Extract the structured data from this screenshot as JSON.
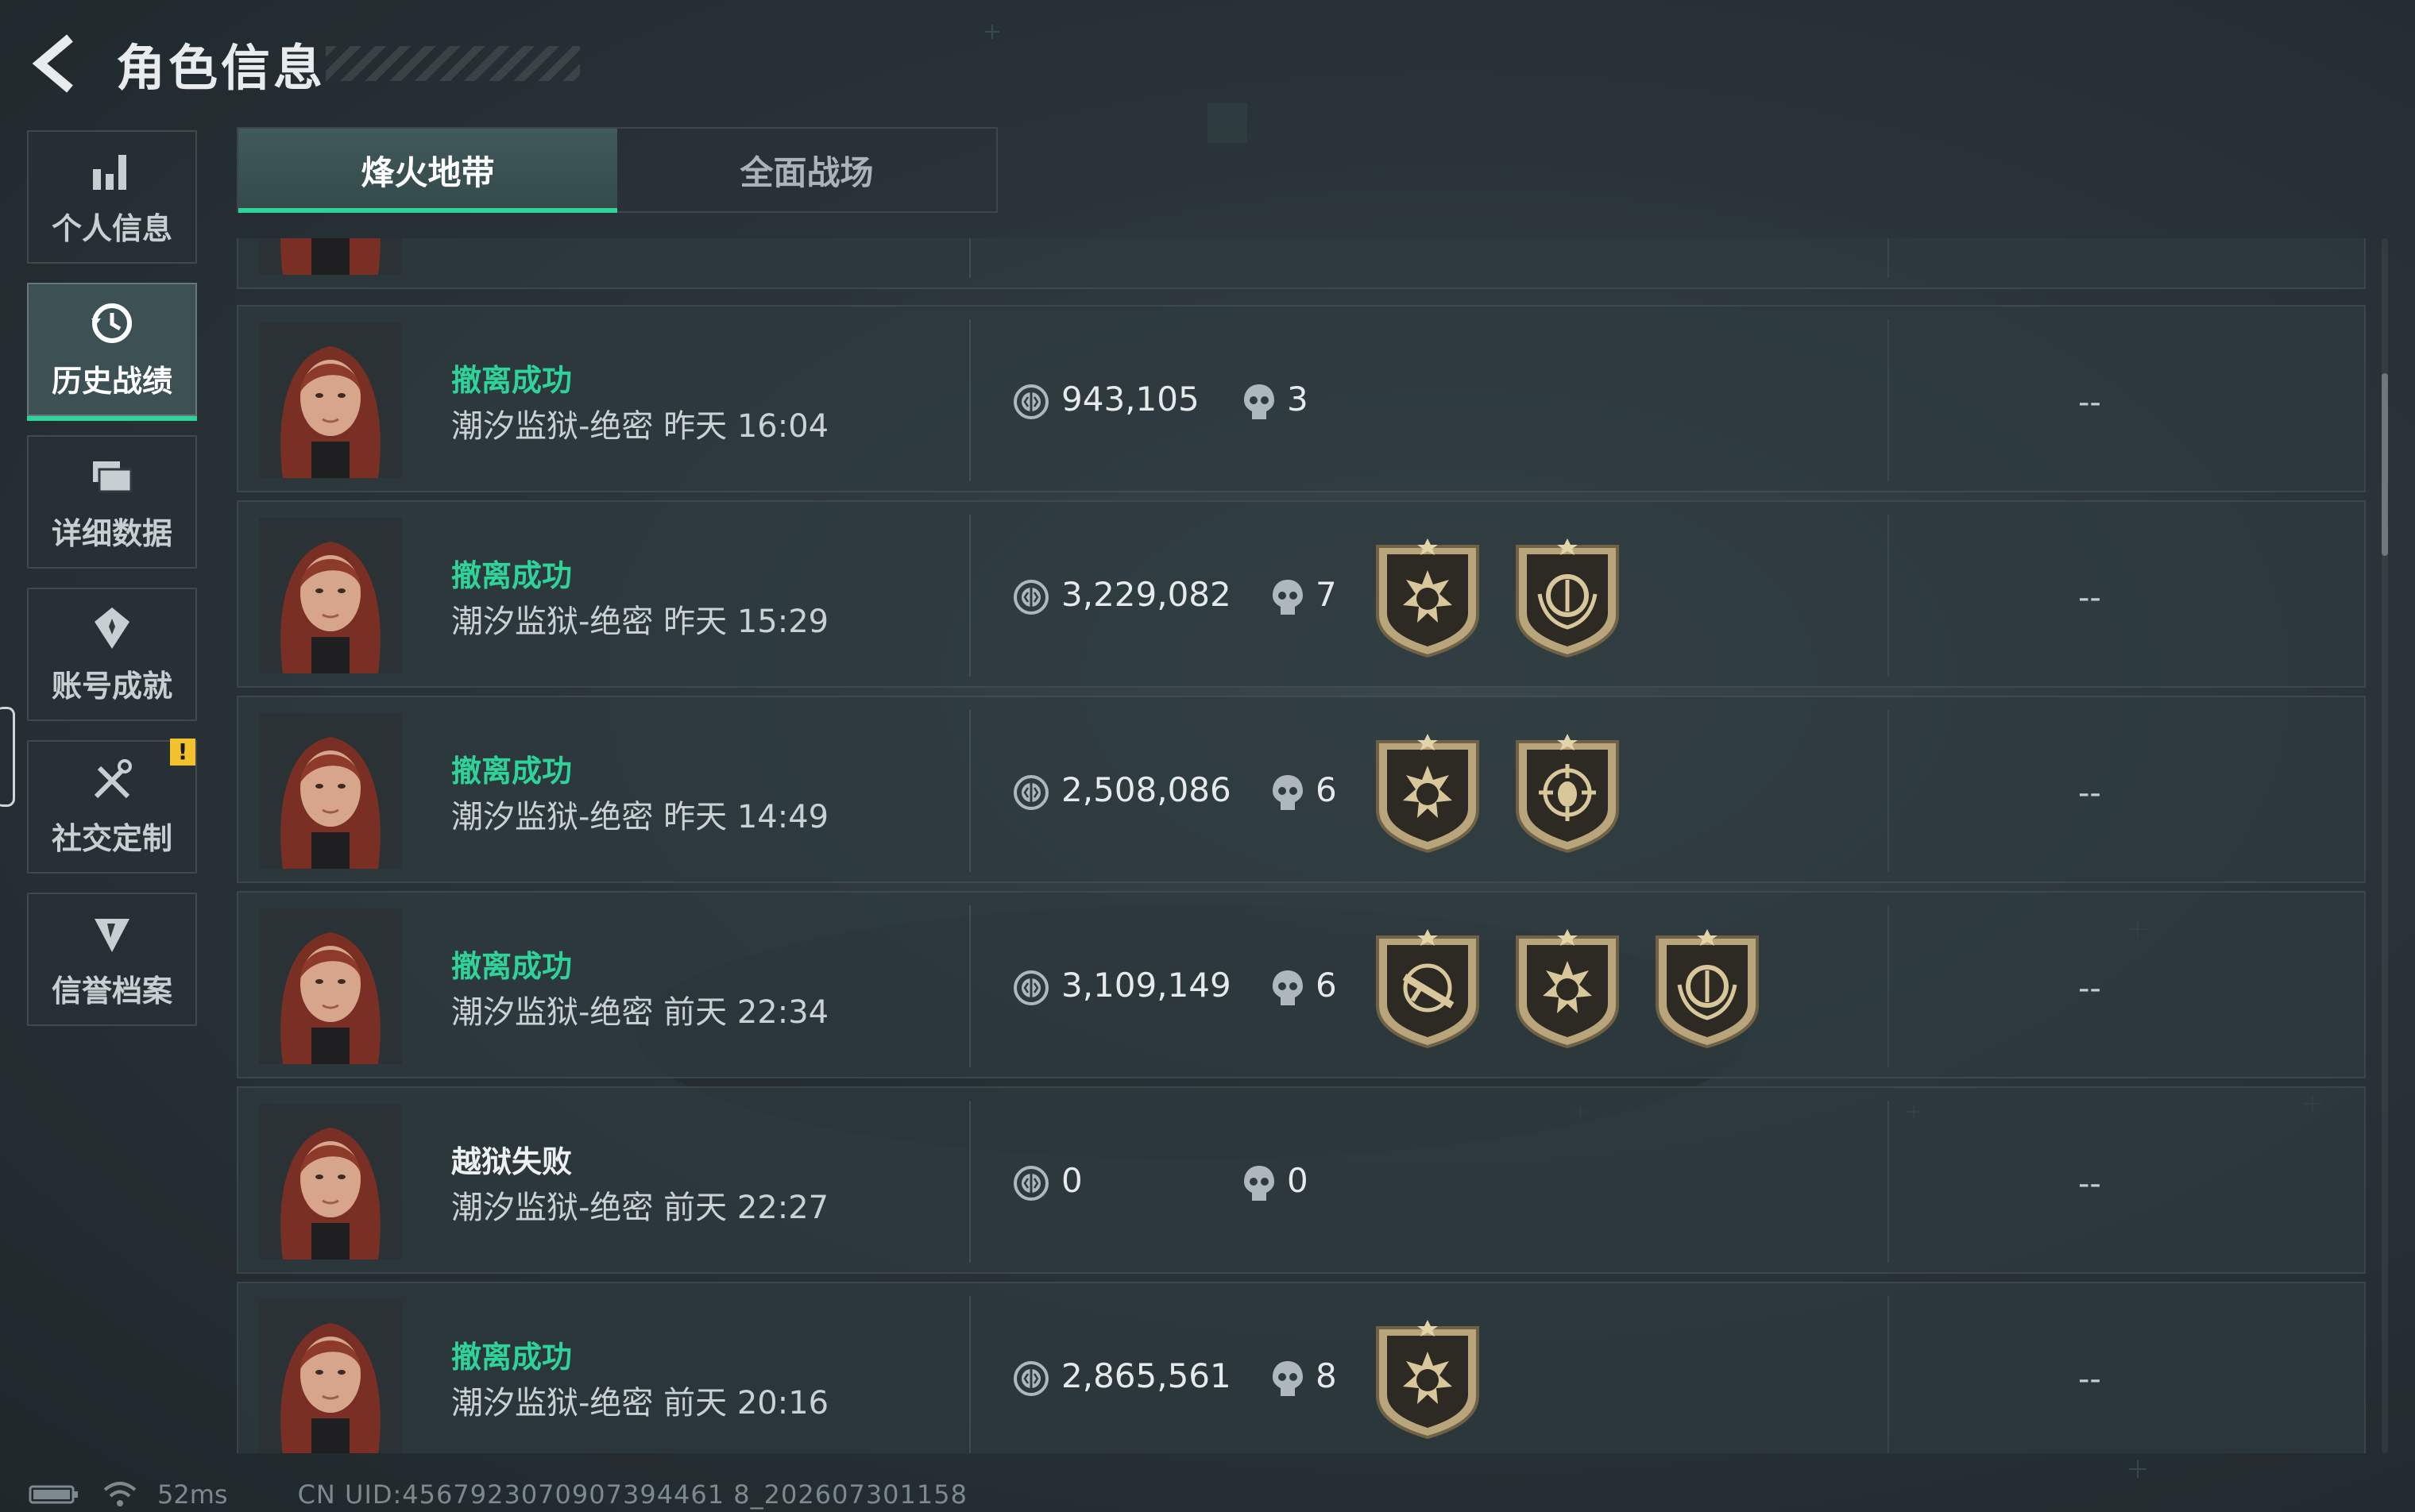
{
  "header": {
    "title": "角色信息",
    "back_icon": "back-arrow-icon"
  },
  "sidenav": {
    "items": [
      {
        "label": "个人信息",
        "icon": "bar-chart-icon",
        "active": false
      },
      {
        "label": "历史战绩",
        "icon": "history-clock-icon",
        "active": true
      },
      {
        "label": "详细数据",
        "icon": "folder-icon",
        "active": false
      },
      {
        "label": "账号成就",
        "icon": "achievement-icon",
        "active": false
      },
      {
        "label": "社交定制",
        "icon": "tools-icon",
        "active": false,
        "alert": "!"
      },
      {
        "label": "信誉档案",
        "icon": "credit-shield-icon",
        "active": false
      }
    ]
  },
  "tabs": [
    {
      "label": "烽火地带",
      "active": true
    },
    {
      "label": "全面战场",
      "active": false
    }
  ],
  "records": [
    {
      "status": "撤离成功",
      "map": "潮汐监狱-绝密 昨天 16:04",
      "value": "943,105",
      "kills": "3",
      "badges": [],
      "rating": "--"
    },
    {
      "status": "撤离成功",
      "map": "潮汐监狱-绝密 昨天 15:29",
      "value": "3,229,082",
      "kills": "7",
      "badges": [
        "skull-burst-medal-icon",
        "laurel-coin-medal-icon"
      ],
      "rating": "--"
    },
    {
      "status": "撤离成功",
      "map": "潮汐监狱-绝密 昨天 14:49",
      "value": "2,508,086",
      "kills": "6",
      "badges": [
        "skull-burst-medal-icon",
        "crosshair-mask-medal-icon"
      ],
      "rating": "--"
    },
    {
      "status": "撤离成功",
      "map": "潮汐监狱-绝密 前天 22:34",
      "value": "3,109,149",
      "kills": "6",
      "badges": [
        "rifle-crosshair-medal-icon",
        "skull-burst-medal-icon",
        "laurel-coin-medal-icon"
      ],
      "rating": "--"
    },
    {
      "status": "越狱失败",
      "map": "潮汐监狱-绝密 前天 22:27",
      "value": "0",
      "kills": "0",
      "badges": [],
      "rating": "--"
    },
    {
      "status": "撤离成功",
      "map": "潮汐监狱-绝密 前天 20:16",
      "value": "2,865,561",
      "kills": "8",
      "badges": [
        "skull-burst-medal-icon"
      ],
      "rating": "--"
    }
  ],
  "footer": {
    "ping": "52ms",
    "uid": "CN UID:4567923070907394461 8_202607301158"
  },
  "colors": {
    "accent": "#2fd39a",
    "badge_gold": "#c8b487",
    "alert": "#f2c12e"
  }
}
